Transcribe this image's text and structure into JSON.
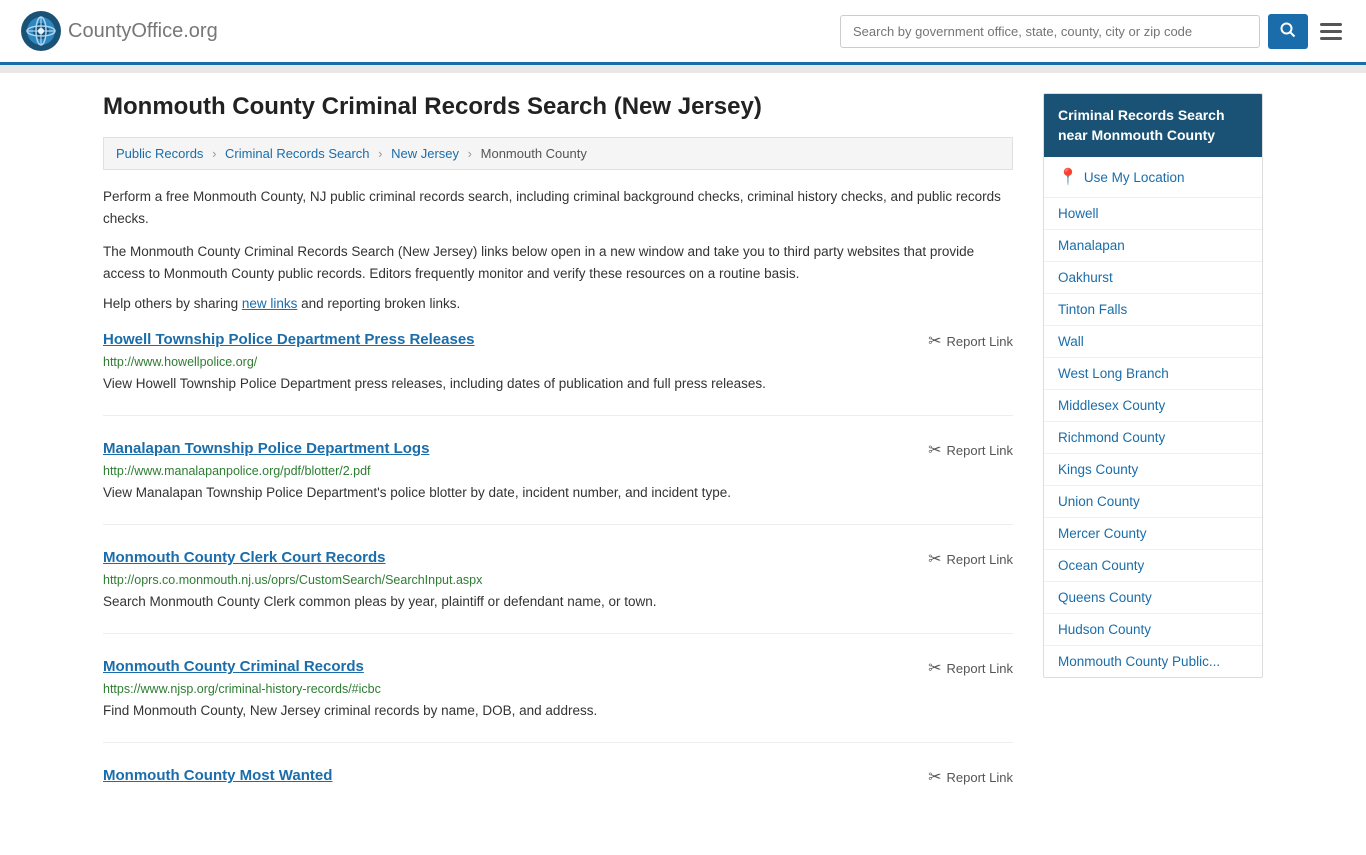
{
  "header": {
    "logo_text": "CountyOffice",
    "logo_suffix": ".org",
    "search_placeholder": "Search by government office, state, county, city or zip code",
    "search_btn_label": "🔍"
  },
  "page": {
    "title": "Monmouth County Criminal Records Search (New Jersey)",
    "breadcrumb": {
      "items": [
        "Public Records",
        "Criminal Records Search",
        "New Jersey",
        "Monmouth County"
      ]
    },
    "intro1": "Perform a free Monmouth County, NJ public criminal records search, including criminal background checks, criminal history checks, and public records checks.",
    "intro2": "The Monmouth County Criminal Records Search (New Jersey) links below open in a new window and take you to third party websites that provide access to Monmouth County public records. Editors frequently monitor and verify these resources on a routine basis.",
    "help": "Help others by sharing new links and reporting broken links.",
    "help_link": "new links"
  },
  "results": [
    {
      "title": "Howell Township Police Department Press Releases",
      "url": "http://www.howellpolice.org/",
      "desc": "View Howell Township Police Department press releases, including dates of publication and full press releases.",
      "report": "Report Link"
    },
    {
      "title": "Manalapan Township Police Department Logs",
      "url": "http://www.manalapanpolice.org/pdf/blotter/2.pdf",
      "desc": "View Manalapan Township Police Department's police blotter by date, incident number, and incident type.",
      "report": "Report Link"
    },
    {
      "title": "Monmouth County Clerk Court Records",
      "url": "http://oprs.co.monmouth.nj.us/oprs/CustomSearch/SearchInput.aspx",
      "desc": "Search Monmouth County Clerk common pleas by year, plaintiff or defendant name, or town.",
      "report": "Report Link"
    },
    {
      "title": "Monmouth County Criminal Records",
      "url": "https://www.njsp.org/criminal-history-records/#icbc",
      "desc": "Find Monmouth County, New Jersey criminal records by name, DOB, and address.",
      "report": "Report Link"
    },
    {
      "title": "Monmouth County Most Wanted",
      "url": "",
      "desc": "",
      "report": "Report Link"
    }
  ],
  "sidebar": {
    "header": "Criminal Records Search near Monmouth County",
    "use_location": "Use My Location",
    "links": [
      "Howell",
      "Manalapan",
      "Oakhurst",
      "Tinton Falls",
      "Wall",
      "West Long Branch",
      "Middlesex County",
      "Richmond County",
      "Kings County",
      "Union County",
      "Mercer County",
      "Ocean County",
      "Queens County",
      "Hudson County",
      "Monmouth County Public..."
    ]
  }
}
